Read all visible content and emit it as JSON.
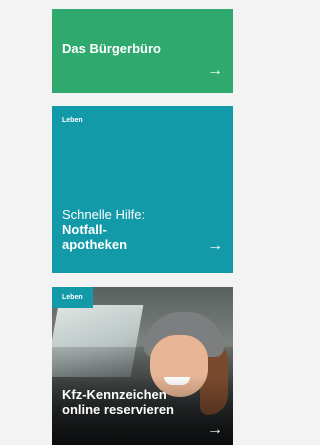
{
  "cards": [
    {
      "title": "Das Bürgerbüro",
      "arrow": "→",
      "color": "#2fa96d"
    },
    {
      "tag": "Leben",
      "subtitle": "Schnelle Hilfe:",
      "title": "Notfall-apotheken",
      "arrow": "→",
      "color": "#139aa8"
    },
    {
      "tag": "Leben",
      "title": "Kfz-Kennzeichen online reservieren",
      "arrow": "→",
      "tag_color": "#139aa8"
    }
  ]
}
